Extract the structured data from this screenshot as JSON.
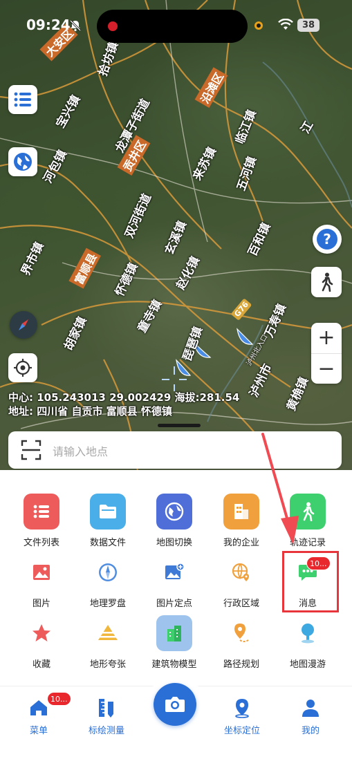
{
  "status_bar": {
    "time": "09:24",
    "battery": "38"
  },
  "map": {
    "places": [
      {
        "name": "大安区",
        "type": "district"
      },
      {
        "name": "拾坊镇",
        "type": "town"
      },
      {
        "name": "宝兴镇",
        "type": "town"
      },
      {
        "name": "龙潭子街道",
        "type": "town"
      },
      {
        "name": "贡井区",
        "type": "district"
      },
      {
        "name": "沿滩区",
        "type": "district"
      },
      {
        "name": "临江镇",
        "type": "town"
      },
      {
        "name": "河包镇",
        "type": "town"
      },
      {
        "name": "来苏镇",
        "type": "town"
      },
      {
        "name": "五河镇",
        "type": "town"
      },
      {
        "name": "双河街道",
        "type": "town"
      },
      {
        "name": "玄溪镇",
        "type": "town"
      },
      {
        "name": "百和镇",
        "type": "town"
      },
      {
        "name": "界市镇",
        "type": "town"
      },
      {
        "name": "富顺县",
        "type": "district"
      },
      {
        "name": "怀德镇",
        "type": "town"
      },
      {
        "name": "赵化镇",
        "type": "town"
      },
      {
        "name": "琵琶镇",
        "type": "town"
      },
      {
        "name": "胡家镇",
        "type": "town"
      },
      {
        "name": "童寺镇",
        "type": "town"
      },
      {
        "name": "万寿镇",
        "type": "town"
      },
      {
        "name": "黄桷镇",
        "type": "town"
      },
      {
        "name": "泸州市",
        "type": "town"
      },
      {
        "name": "江",
        "type": "town"
      }
    ],
    "road_badge": "G76",
    "road_exit": "泸州北入口",
    "coords_line": "中心:  105.243013 29.002429 海拔:281.54",
    "address_line": "地址:  四川省 自贡市 富顺县 怀德镇",
    "help_glyph": "?",
    "zoom_in": "+",
    "zoom_out": "−"
  },
  "search": {
    "placeholder": "请输入地点"
  },
  "grid": [
    {
      "label": "文件列表",
      "icon": "file-list-icon",
      "color": "#ee5b5b"
    },
    {
      "label": "数据文件",
      "icon": "folder-icon",
      "color": "#4aaee8"
    },
    {
      "label": "地图切换",
      "icon": "globe-icon",
      "color": "#4f6ed8"
    },
    {
      "label": "我的企业",
      "icon": "building-icon",
      "color": "#f0a03c"
    },
    {
      "label": "轨迹记录",
      "icon": "walk-icon",
      "color": "#3ecf6e"
    },
    {
      "label": "图片",
      "icon": "image-icon",
      "color": "#ee5b5b"
    },
    {
      "label": "地理罗盘",
      "icon": "compass-icon",
      "color": "#4f8de0"
    },
    {
      "label": "图片定点",
      "icon": "image-pin-icon",
      "color": "#3f7bd6"
    },
    {
      "label": "行政区域",
      "icon": "region-icon",
      "color": "#f0a03c"
    },
    {
      "label": "消息",
      "icon": "message-icon",
      "color": "#3ecf6e",
      "badge": "10..."
    },
    {
      "label": "收藏",
      "icon": "star-icon",
      "color": "#ee5b5b"
    },
    {
      "label": "地形夸张",
      "icon": "terrain-icon",
      "color": "#f0b73c"
    },
    {
      "label": "建筑物模型",
      "icon": "building-model-icon",
      "color": "#9ec3ec"
    },
    {
      "label": "路径规划",
      "icon": "route-icon",
      "color": "#f0a03c"
    },
    {
      "label": "地图漫游",
      "icon": "roam-icon",
      "color": "#3ea9e0"
    }
  ],
  "nav": {
    "menu": "菜单",
    "menu_badge": "10...",
    "measure": "标绘测量",
    "locate": "坐标定位",
    "mine": "我的"
  },
  "colors": {
    "accent": "#2a6fd6",
    "highlight": "#e8343b"
  }
}
